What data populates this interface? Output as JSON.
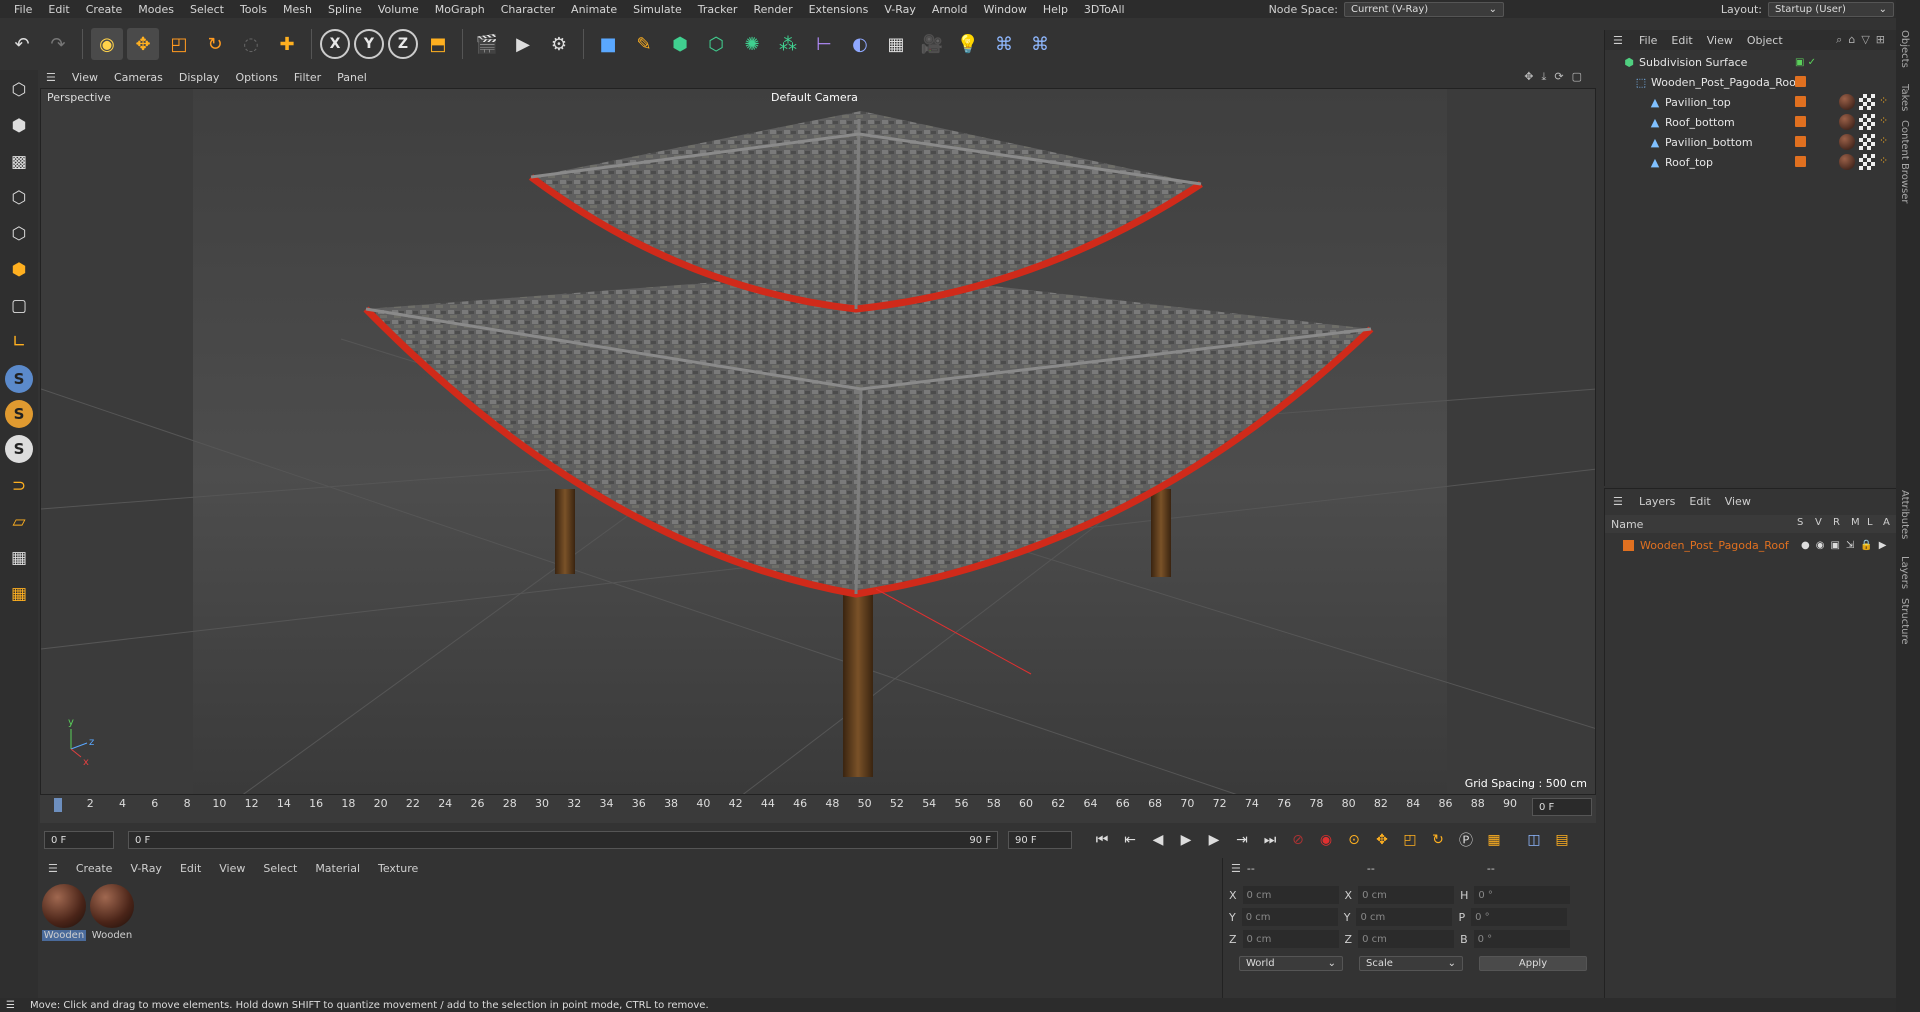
{
  "menubar": {
    "items": [
      "File",
      "Edit",
      "Create",
      "Modes",
      "Select",
      "Tools",
      "Mesh",
      "Spline",
      "Volume",
      "MoGraph",
      "Character",
      "Animate",
      "Simulate",
      "Tracker",
      "Render",
      "Extensions",
      "V-Ray",
      "Arnold",
      "Window",
      "Help",
      "3DToAll"
    ],
    "node_space_label": "Node Space:",
    "node_space_value": "Current (V-Ray)",
    "layout_label": "Layout:",
    "layout_value": "Startup (User)"
  },
  "viewport_menu": [
    "View",
    "Cameras",
    "Display",
    "Options",
    "Filter",
    "Panel"
  ],
  "viewport": {
    "label": "Perspective",
    "camera": "Default Camera",
    "grid_spacing": "Grid Spacing : 500 cm"
  },
  "timeline": {
    "ticks": [
      0,
      2,
      4,
      6,
      8,
      10,
      12,
      14,
      16,
      18,
      20,
      22,
      24,
      26,
      28,
      30,
      32,
      34,
      36,
      38,
      40,
      42,
      44,
      46,
      48,
      50,
      52,
      54,
      56,
      58,
      60,
      62,
      64,
      66,
      68,
      70,
      72,
      74,
      76,
      78,
      80,
      82,
      84,
      86,
      88,
      90
    ],
    "end_field": "0 F"
  },
  "transport": {
    "start": "0 F",
    "range_start": "0 F",
    "range_end": "90 F",
    "end": "90 F"
  },
  "material_menu": [
    "Create",
    "V-Ray",
    "Edit",
    "View",
    "Select",
    "Material",
    "Texture"
  ],
  "materials": [
    {
      "name": "Wooden"
    },
    {
      "name": "Wooden"
    }
  ],
  "coords": {
    "header": [
      "--",
      "--",
      "--"
    ],
    "rows": [
      {
        "a": "X",
        "av": "0 cm",
        "b": "X",
        "bv": "0 cm",
        "c": "H",
        "cv": "0 °"
      },
      {
        "a": "Y",
        "av": "0 cm",
        "b": "Y",
        "bv": "0 cm",
        "c": "P",
        "cv": "0 °"
      },
      {
        "a": "Z",
        "av": "0 cm",
        "b": "Z",
        "bv": "0 cm",
        "c": "B",
        "cv": "0 °"
      }
    ],
    "space": "World",
    "mode": "Scale",
    "apply": "Apply"
  },
  "object_manager": {
    "menu": [
      "File",
      "Edit",
      "View",
      "Object"
    ],
    "objects": [
      {
        "name": "Subdivision Surface",
        "level": 0
      },
      {
        "name": "Wooden_Post_Pagoda_Roof",
        "level": 1
      },
      {
        "name": "Pavilion_top",
        "level": 2
      },
      {
        "name": "Roof_bottom",
        "level": 2
      },
      {
        "name": "Pavilion_bottom",
        "level": 2
      },
      {
        "name": "Roof_top",
        "level": 2
      }
    ]
  },
  "layer_manager": {
    "menu": [
      "Layers",
      "Edit",
      "View"
    ],
    "name_header": "Name",
    "columns": [
      "S",
      "V",
      "R",
      "M",
      "L",
      "A"
    ],
    "layers": [
      {
        "name": "Wooden_Post_Pagoda_Roof",
        "color": "#e07020"
      }
    ]
  },
  "right_tabs": [
    "Objects",
    "Takes",
    "Content Browser",
    "Attributes",
    "Layers",
    "Structure"
  ],
  "status": "Move: Click and drag to move elements. Hold down SHIFT to quantize movement / add to the selection in point mode, CTRL to remove.",
  "colors": {
    "accent": "#e07020",
    "roof_trim": "#d02a1a",
    "post": "#5a3a1e"
  }
}
